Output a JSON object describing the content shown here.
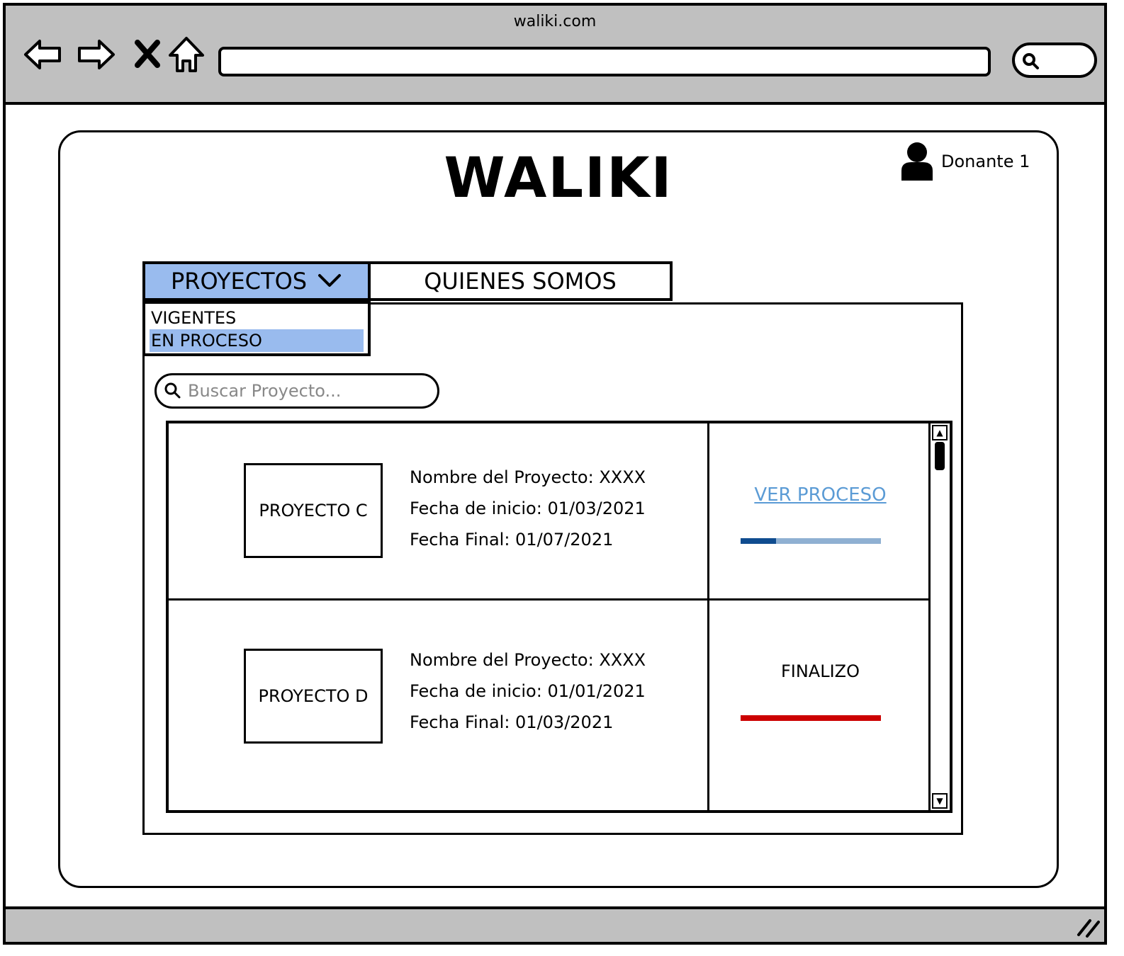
{
  "browser": {
    "title": "waliki.com"
  },
  "header": {
    "brand": "WALIKI",
    "user_name": "Donante 1"
  },
  "nav": {
    "tabs": [
      {
        "label": "PROYECTOS"
      },
      {
        "label": "QUIENES SOMOS"
      }
    ],
    "dropdown": {
      "items": [
        {
          "label": "VIGENTES"
        },
        {
          "label": "EN PROCESO"
        }
      ],
      "selected": "EN PROCESO"
    }
  },
  "search": {
    "placeholder": "Buscar Proyecto..."
  },
  "projects": [
    {
      "thumb_label": "PROYECTO C",
      "name_line": "Nombre del Proyecto: XXXX",
      "start_line": "Fecha de inicio: 01/03/2021",
      "end_line": "Fecha Final: 01/07/2021",
      "status": "VER PROCESO",
      "progress": 0.25
    },
    {
      "thumb_label": "PROYECTO D",
      "name_line": "Nombre del Proyecto: XXXX",
      "start_line": "Fecha de inicio: 01/01/2021",
      "end_line": "Fecha Final: 01/03/2021",
      "status": "FINALIZO",
      "progress": 1.0
    }
  ],
  "colors": {
    "tab_active": "#99bbee",
    "link": "#5b9bd5",
    "progress_fill": "#0f4c8f",
    "progress_track": "#8fb0d2",
    "finished": "#cc0000",
    "chrome": "#c0c0c0"
  }
}
